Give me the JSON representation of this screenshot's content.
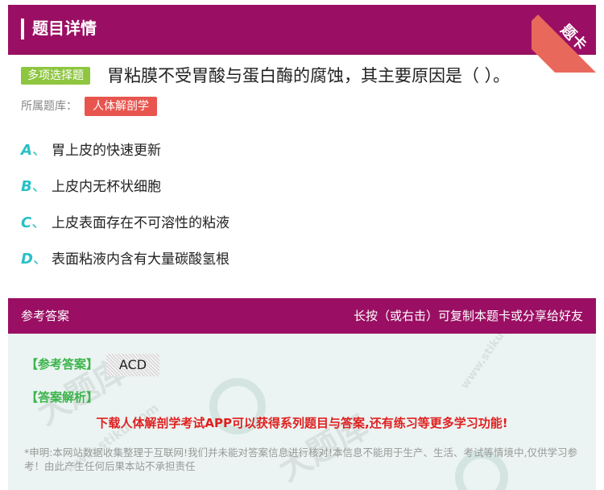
{
  "header": {
    "title": "题目详情"
  },
  "ribbon": {
    "text": "题卡"
  },
  "question": {
    "type_badge": "多项选择题",
    "text": "胃粘膜不受胃酸与蛋白酶的腐蚀，其主要原因是（ ）。",
    "library_label": "所属题库：",
    "library_name": "人体解剖学"
  },
  "options": [
    {
      "letter": "A",
      "sep": "、",
      "text": "胃上皮的快速更新"
    },
    {
      "letter": "B",
      "sep": "、",
      "text": "上皮内无杯状细胞"
    },
    {
      "letter": "C",
      "sep": "、",
      "text": "上皮表面存在不可溶性的粘液"
    },
    {
      "letter": "D",
      "sep": "、",
      "text": "表面粘液内含有大量碳酸氢根"
    }
  ],
  "answer_section": {
    "title": "参考答案",
    "share_hint": "长按（或右击）可复制本题卡或分享给好友",
    "ref_label": "【参考答案】",
    "ref_value": "ACD",
    "analysis_label": "【答案解析】",
    "promo": "下载人体解剖学考试APP可以获得系列题目与答案,还有练习等更多学习功能!",
    "disclaimer": "*申明:本网站数据收集整理于互联网!我们并未能对答案信息进行核对!本信息不能用于生产、生活、考试等情境中,仅供学习参考！由此产生任何后果本站不承担责任"
  },
  "watermark": {
    "brand": "大题库",
    "site": "www.stiku.com"
  },
  "colors": {
    "header_bg": "#9a0f63",
    "ribbon": "#e9685c",
    "type_badge": "#8ec640",
    "library_badge": "#e8554e",
    "option_letter": "#2ac0c6",
    "answer_label": "#3bb44a",
    "promo": "#e02020",
    "answer_bg": "#ebf4f2"
  }
}
